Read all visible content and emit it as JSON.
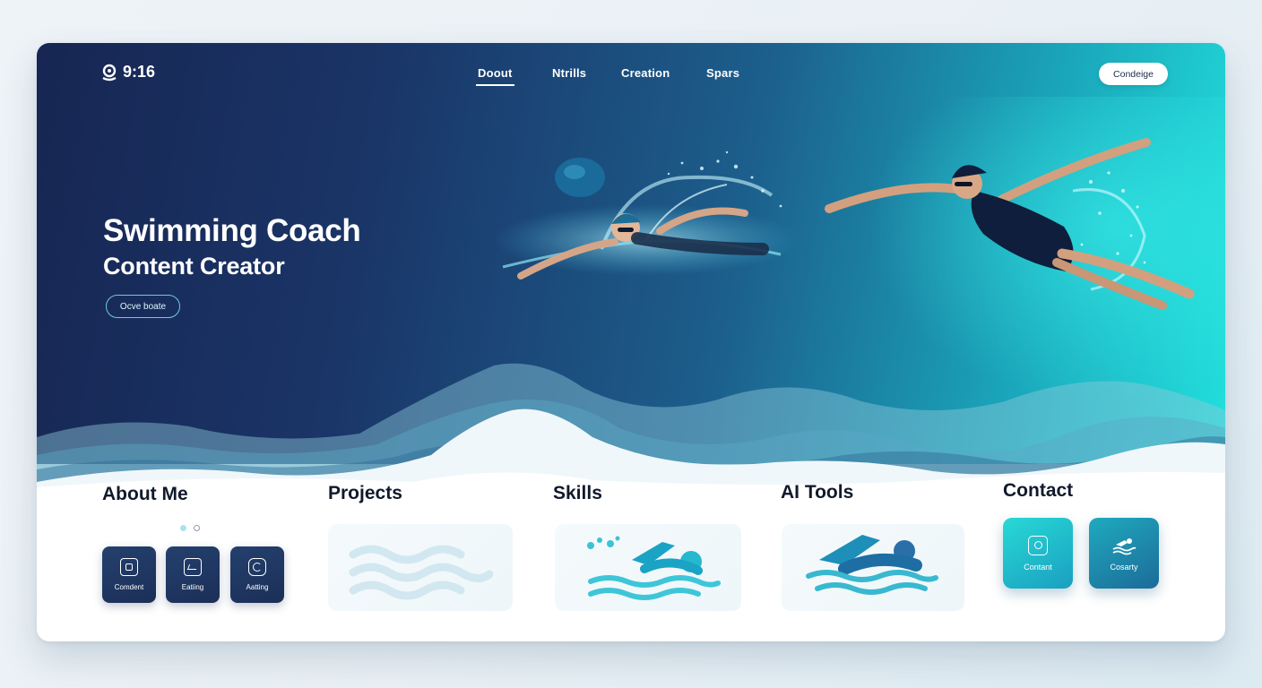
{
  "header": {
    "time": "9:16",
    "nav": [
      {
        "label": "Doout"
      },
      {
        "label": "Ntrills"
      },
      {
        "label": "Creation"
      },
      {
        "label": "Spars"
      }
    ],
    "cta_label": "Condeige"
  },
  "hero": {
    "title": "Swimming Coach",
    "subtitle": "Content Creator",
    "button_label": "Ocve boate"
  },
  "sections": {
    "about": {
      "title": "About Me",
      "tiles": [
        {
          "label": "Comdent",
          "icon": "frame-icon"
        },
        {
          "label": "Eatiing",
          "icon": "image-icon"
        },
        {
          "label": "Aatting",
          "icon": "refresh-icon"
        }
      ]
    },
    "projects": {
      "title": "Projects"
    },
    "skills": {
      "title": "Skills"
    },
    "ai_tools": {
      "title": "AI Tools"
    },
    "contact": {
      "title": "Contact",
      "tiles": [
        {
          "label": "Contant",
          "icon": "camera-icon"
        },
        {
          "label": "Cosarty",
          "icon": "swimmer-icon"
        }
      ]
    }
  },
  "colors": {
    "hero_dark": "#172653",
    "hero_mid": "#1c5e8c",
    "hero_light": "#22e0dc",
    "tile_navy": "#1b2f57",
    "contact_cyan": "#1fc6cf",
    "contact_teal": "#1c93ad"
  }
}
